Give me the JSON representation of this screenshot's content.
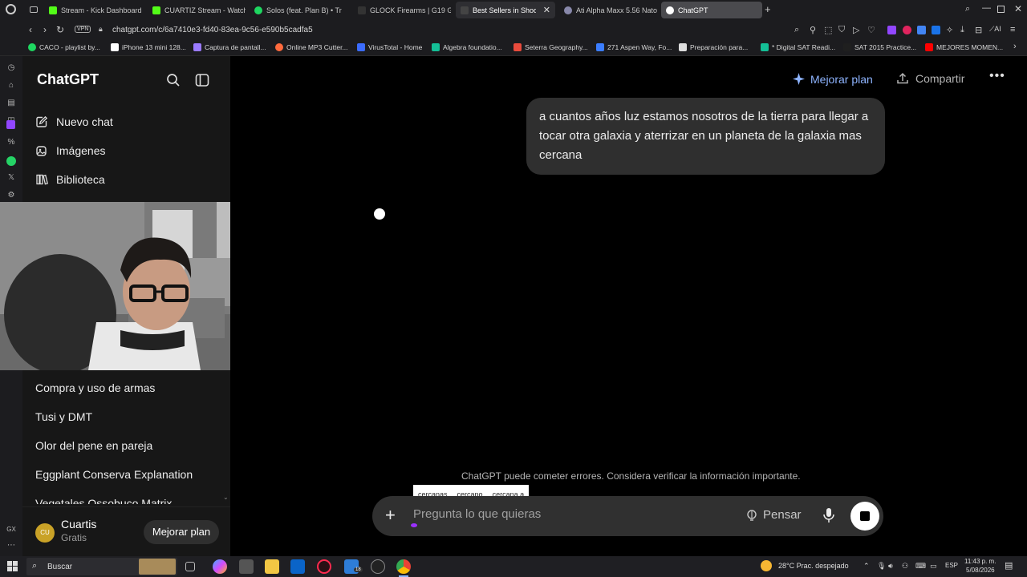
{
  "browser": {
    "tabs": [
      {
        "label": "Stream - Kick Dashboard",
        "color": "#53fc18"
      },
      {
        "label": "CUARTIZ Stream - Watch L",
        "color": "#53fc18"
      },
      {
        "label": "Solos (feat. Plan B) • Tr",
        "color": "#1ed760"
      },
      {
        "label": "GLOCK Firearms | G19 Gen",
        "color": "#333333"
      },
      {
        "label": "Best Sellers in Shooting",
        "color": "#444444"
      },
      {
        "label": "Ati Alpha Maxx 5.56 Nato",
        "color": "#8888aa"
      },
      {
        "label": "ChatGPT",
        "color": "#ffffff"
      }
    ],
    "vpn_label": "VPN",
    "url": "chatgpt.com/c/6a7410e3-fd40-83ea-9c56-e590b5cadfa5",
    "bookmarks": [
      {
        "label": "CACO - playlist by...",
        "color": "#1ed760"
      },
      {
        "label": "iPhone 13 mini 128...",
        "color": "#ffffff"
      },
      {
        "label": "Captura de pantall...",
        "color": "#9b7bff"
      },
      {
        "label": "Online MP3 Cutter...",
        "color": "#ff6a3d"
      },
      {
        "label": "VirusTotal - Home",
        "color": "#3b6cff"
      },
      {
        "label": "Algebra foundatio...",
        "color": "#14bf96"
      },
      {
        "label": "Seterra Geography...",
        "color": "#e94b3c"
      },
      {
        "label": "271 Aspen Way, Fo...",
        "color": "#3b7dff"
      },
      {
        "label": "Preparación para...",
        "color": "#dddddd"
      },
      {
        "label": "* Digital SAT Readi...",
        "color": "#14bf96"
      },
      {
        "label": "SAT 2015 Practice...",
        "color": "#1f1f1f"
      },
      {
        "label": "MEJORES MOMEN...",
        "color": "#ff0000"
      }
    ]
  },
  "sidebar": {
    "brand": "ChatGPT",
    "items": [
      {
        "label": "Nuevo chat",
        "icon": "edit-icon"
      },
      {
        "label": "Imágenes",
        "icon": "images-icon"
      },
      {
        "label": "Biblioteca",
        "icon": "library-icon"
      }
    ],
    "chats": [
      "Compra y uso de armas",
      "Tusi y DMT",
      "Olor del pene en pareja",
      "Eggplant Conserva Explanation",
      "Vegetales Ossobuco Matrix"
    ],
    "user": {
      "initials": "CU",
      "name": "Cuartis",
      "plan": "Gratis",
      "upgrade_label": "Mejorar plan"
    }
  },
  "header": {
    "upgrade_label": "Mejorar plan",
    "share_label": "Compartir"
  },
  "conversation": {
    "user_message": "a cuantos años luz estamos nosotros de la tierra para llegar a tocar otra galaxia y aterrizar en un planeta de la galaxia mas cercana"
  },
  "disclaimer": "ChatGPT puede cometer errores. Considera verificar la información importante.",
  "composer": {
    "placeholder": "Pregunta lo que quieras",
    "think_label": "Pensar",
    "suggestions": [
      "cercanas",
      "cercano",
      "cercana a"
    ]
  },
  "taskbar": {
    "search_label": "Buscar",
    "weather": "28°C  Prac. despejado",
    "lang": "ESP",
    "time": "11:43 p. m.",
    "date": "5/08/2026",
    "badge": "18"
  },
  "colors": {
    "accent": "#8eb4ff",
    "sidebar_bg": "#171717",
    "composer_bg": "#303030"
  }
}
